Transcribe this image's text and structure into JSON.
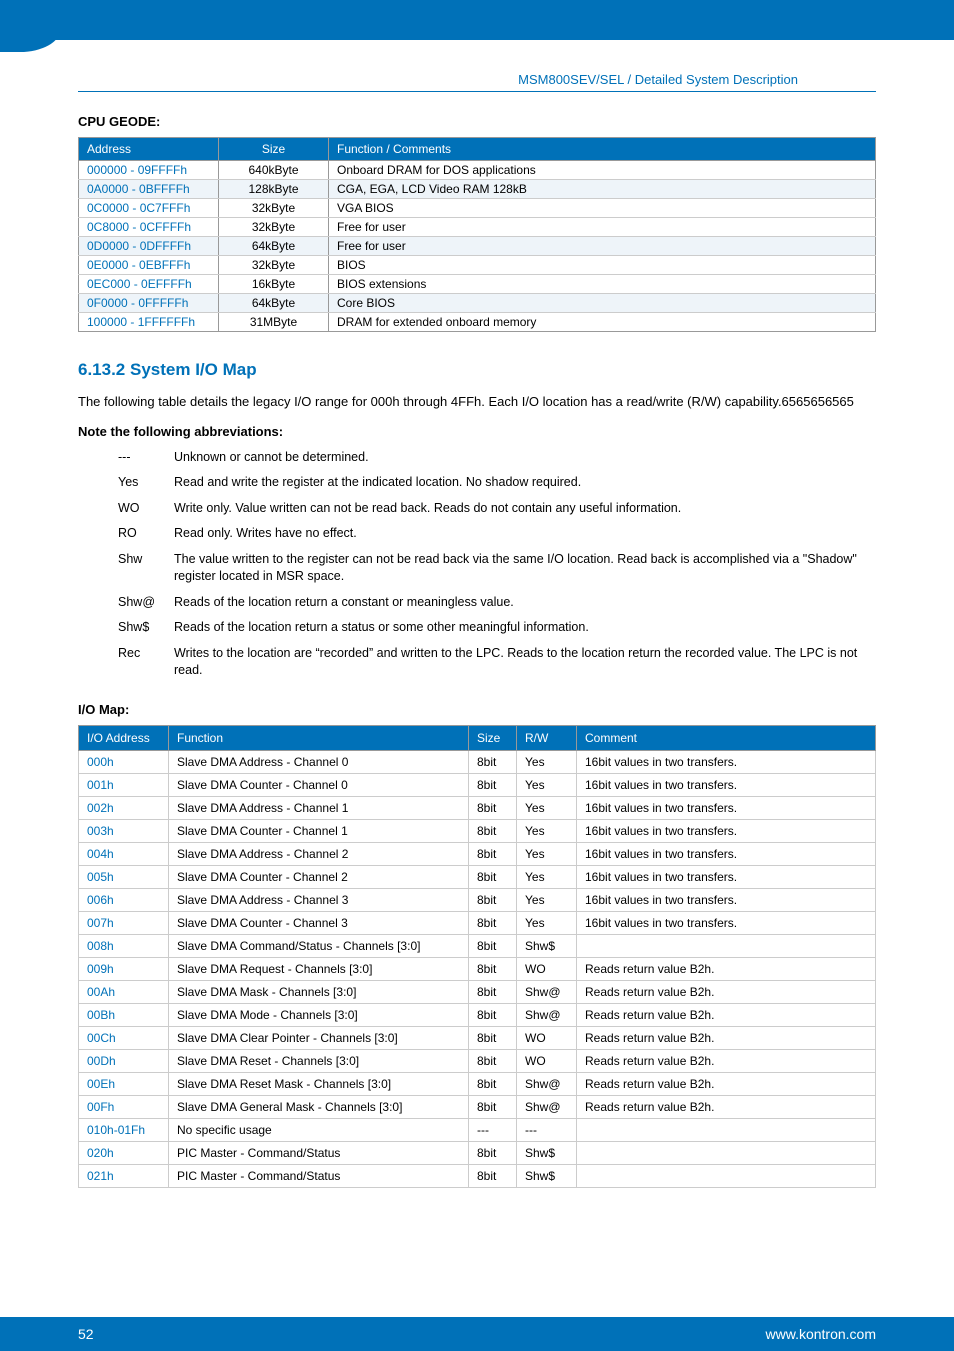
{
  "breadcrumb": "MSM800SEV/SEL / Detailed System Description",
  "cpu_geode_title": "CPU GEODE:",
  "mem_headers": {
    "address": "Address",
    "size": "Size",
    "func": "Function / Comments"
  },
  "mem_rows": [
    {
      "addr": "000000 - 09FFFFh",
      "size": "640kByte",
      "func": "Onboard DRAM for DOS applications",
      "shade": false
    },
    {
      "addr": "0A0000 - 0BFFFFh",
      "size": "128kByte",
      "func": "CGA, EGA, LCD Video RAM 128kB",
      "shade": true
    },
    {
      "addr": "0C0000 - 0C7FFFh",
      "size": "32kByte",
      "func": "VGA BIOS",
      "shade": false
    },
    {
      "addr": "0C8000 - 0CFFFFh",
      "size": "32kByte",
      "func": "Free for user",
      "shade": false
    },
    {
      "addr": "0D0000 - 0DFFFFh",
      "size": "64kByte",
      "func": "Free for user",
      "shade": true
    },
    {
      "addr": "0E0000 - 0EBFFFh",
      "size": "32kByte",
      "func": "BIOS",
      "shade": false
    },
    {
      "addr": "0EC000 - 0EFFFFh",
      "size": "16kByte",
      "func": "BIOS extensions",
      "shade": false
    },
    {
      "addr": "0F0000 - 0FFFFFh",
      "size": "64kByte",
      "func": "Core BIOS",
      "shade": true
    },
    {
      "addr": "100000 - 1FFFFFFh",
      "size": "31MByte",
      "func": "DRAM for extended onboard memory",
      "shade": false
    }
  ],
  "sys_heading": "6.13.2  System I/O Map",
  "sys_para": "The following table details the legacy I/O range for 000h through 4FFh. Each I/O location has a read/write (R/W) capability.6565656565",
  "note_title": "Note the following abbreviations:",
  "abbrev": [
    {
      "key": "---",
      "val": "Unknown or cannot be determined."
    },
    {
      "key": "Yes",
      "val": "Read and write the register at the indicated location. No shadow required."
    },
    {
      "key": "WO",
      "val": "Write only. Value written can not be read back. Reads do not contain any useful information."
    },
    {
      "key": "RO",
      "val": "Read only. Writes have no effect."
    },
    {
      "key": "Shw",
      "val": "The value written to the register can not be read back via the same I/O location. Read back is accomplished via a \"Shadow\" register located in MSR space."
    },
    {
      "key": "Shw@",
      "val": "Reads of the location return a constant or meaningless value."
    },
    {
      "key": "Shw$",
      "val": "Reads of the location return a status or some other meaningful information."
    },
    {
      "key": "Rec",
      "val": "Writes to the location are “recorded” and written to the LPC. Reads to the location return the recorded value. The LPC is not read."
    }
  ],
  "io_map_title": "I/O Map:",
  "io_headers": {
    "addr": "I/O Address",
    "func": "Function",
    "size": "Size",
    "rw": "R/W",
    "comment": "Comment"
  },
  "io_rows": [
    {
      "addr": "000h",
      "func": "Slave DMA Address - Channel 0",
      "size": "8bit",
      "rw": "Yes",
      "comment": "16bit values in two transfers."
    },
    {
      "addr": "001h",
      "func": "Slave DMA Counter - Channel 0",
      "size": "8bit",
      "rw": "Yes",
      "comment": "16bit values in two transfers."
    },
    {
      "addr": "002h",
      "func": "Slave DMA Address - Channel 1",
      "size": "8bit",
      "rw": "Yes",
      "comment": "16bit values in two transfers."
    },
    {
      "addr": "003h",
      "func": "Slave DMA Counter - Channel 1",
      "size": "8bit",
      "rw": "Yes",
      "comment": "16bit values in two transfers."
    },
    {
      "addr": "004h",
      "func": "Slave DMA Address - Channel 2",
      "size": "8bit",
      "rw": "Yes",
      "comment": "16bit values in two transfers."
    },
    {
      "addr": "005h",
      "func": "Slave DMA Counter - Channel 2",
      "size": "8bit",
      "rw": "Yes",
      "comment": "16bit values in two transfers."
    },
    {
      "addr": "006h",
      "func": "Slave DMA Address - Channel 3",
      "size": "8bit",
      "rw": "Yes",
      "comment": "16bit values in two transfers."
    },
    {
      "addr": "007h",
      "func": "Slave DMA Counter - Channel 3",
      "size": "8bit",
      "rw": "Yes",
      "comment": "16bit values in two transfers."
    },
    {
      "addr": "008h",
      "func": "Slave DMA Command/Status - Channels [3:0]",
      "size": "8bit",
      "rw": "Shw$",
      "comment": ""
    },
    {
      "addr": "009h",
      "func": "Slave DMA Request - Channels [3:0]",
      "size": "8bit",
      "rw": "WO",
      "comment": "Reads return value B2h."
    },
    {
      "addr": "00Ah",
      "func": "Slave DMA Mask - Channels [3:0]",
      "size": "8bit",
      "rw": "Shw@",
      "comment": "Reads return value B2h."
    },
    {
      "addr": "00Bh",
      "func": "Slave DMA Mode - Channels [3:0]",
      "size": "8bit",
      "rw": "Shw@",
      "comment": "Reads return value B2h."
    },
    {
      "addr": "00Ch",
      "func": "Slave DMA Clear Pointer - Channels [3:0]",
      "size": "8bit",
      "rw": "WO",
      "comment": "Reads return value B2h."
    },
    {
      "addr": "00Dh",
      "func": "Slave DMA Reset - Channels [3:0]",
      "size": "8bit",
      "rw": "WO",
      "comment": "Reads return value B2h."
    },
    {
      "addr": "00Eh",
      "func": "Slave DMA Reset Mask - Channels [3:0]",
      "size": "8bit",
      "rw": "Shw@",
      "comment": "Reads return value B2h."
    },
    {
      "addr": "00Fh",
      "func": "Slave DMA General Mask - Channels [3:0]",
      "size": "8bit",
      "rw": "Shw@",
      "comment": "Reads return value B2h."
    },
    {
      "addr": "010h-01Fh",
      "func": "No specific usage",
      "size": "---",
      "rw": "---",
      "comment": ""
    },
    {
      "addr": "020h",
      "func": "PIC Master - Command/Status",
      "size": "8bit",
      "rw": "Shw$",
      "comment": ""
    },
    {
      "addr": "021h",
      "func": "PIC Master - Command/Status",
      "size": "8bit",
      "rw": "Shw$",
      "comment": ""
    }
  ],
  "footer": {
    "page": "52",
    "url": "www.kontron.com"
  }
}
